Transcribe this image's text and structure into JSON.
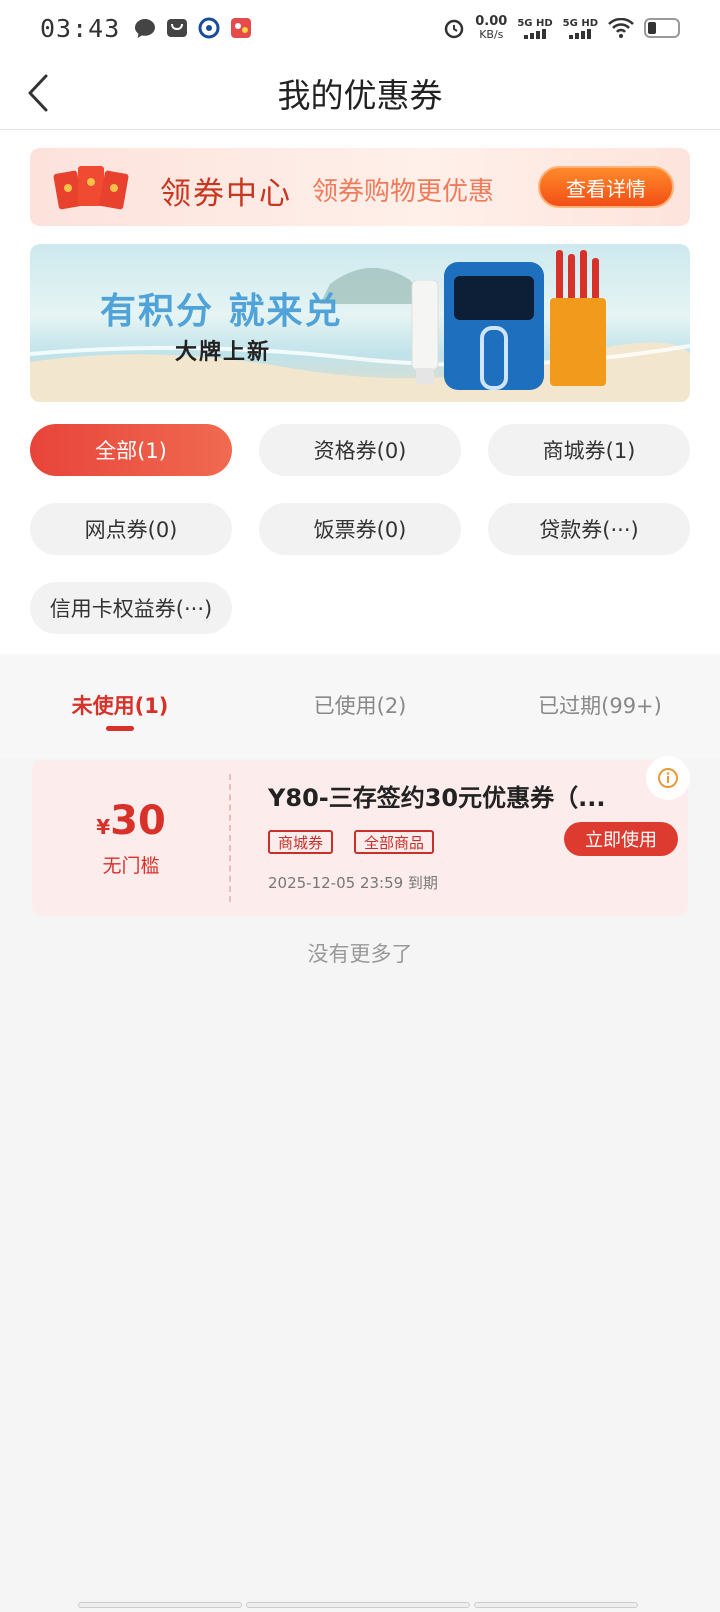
{
  "status_bar": {
    "time": "03:43",
    "speed_value": "0.00",
    "speed_unit": "KB/s",
    "net1": "5G HD",
    "net2": "5G HD"
  },
  "nav": {
    "title": "我的优惠券"
  },
  "coupon_center": {
    "title": "领券中心",
    "subtitle": "领券购物更优惠",
    "button": "查看详情"
  },
  "banner": {
    "title": "有积分 就来兑",
    "subtitle": "大牌上新"
  },
  "filters": [
    {
      "label": "全部(1)",
      "active": true
    },
    {
      "label": "资格券(0)"
    },
    {
      "label": "商城券(1)"
    },
    {
      "label": "网点券(0)"
    },
    {
      "label": "饭票券(0)"
    },
    {
      "label": "贷款券(···)"
    },
    {
      "label": "信用卡权益券(···)"
    }
  ],
  "tabs": [
    {
      "label": "未使用(1)",
      "active": true
    },
    {
      "label": "已使用(2)"
    },
    {
      "label": "已过期(99+)"
    }
  ],
  "coupon": {
    "currency": "¥",
    "amount": "30",
    "condition": "无门槛",
    "name": "Y80-三存签约30元优惠券（...",
    "tags": [
      "商城券",
      "全部商品"
    ],
    "expiry": "2025-12-05 23:59 到期",
    "use_button": "立即使用"
  },
  "footer_note": "没有更多了",
  "colors": {
    "primary_red": "#d8312a",
    "accent_orange": "#f24f16"
  }
}
